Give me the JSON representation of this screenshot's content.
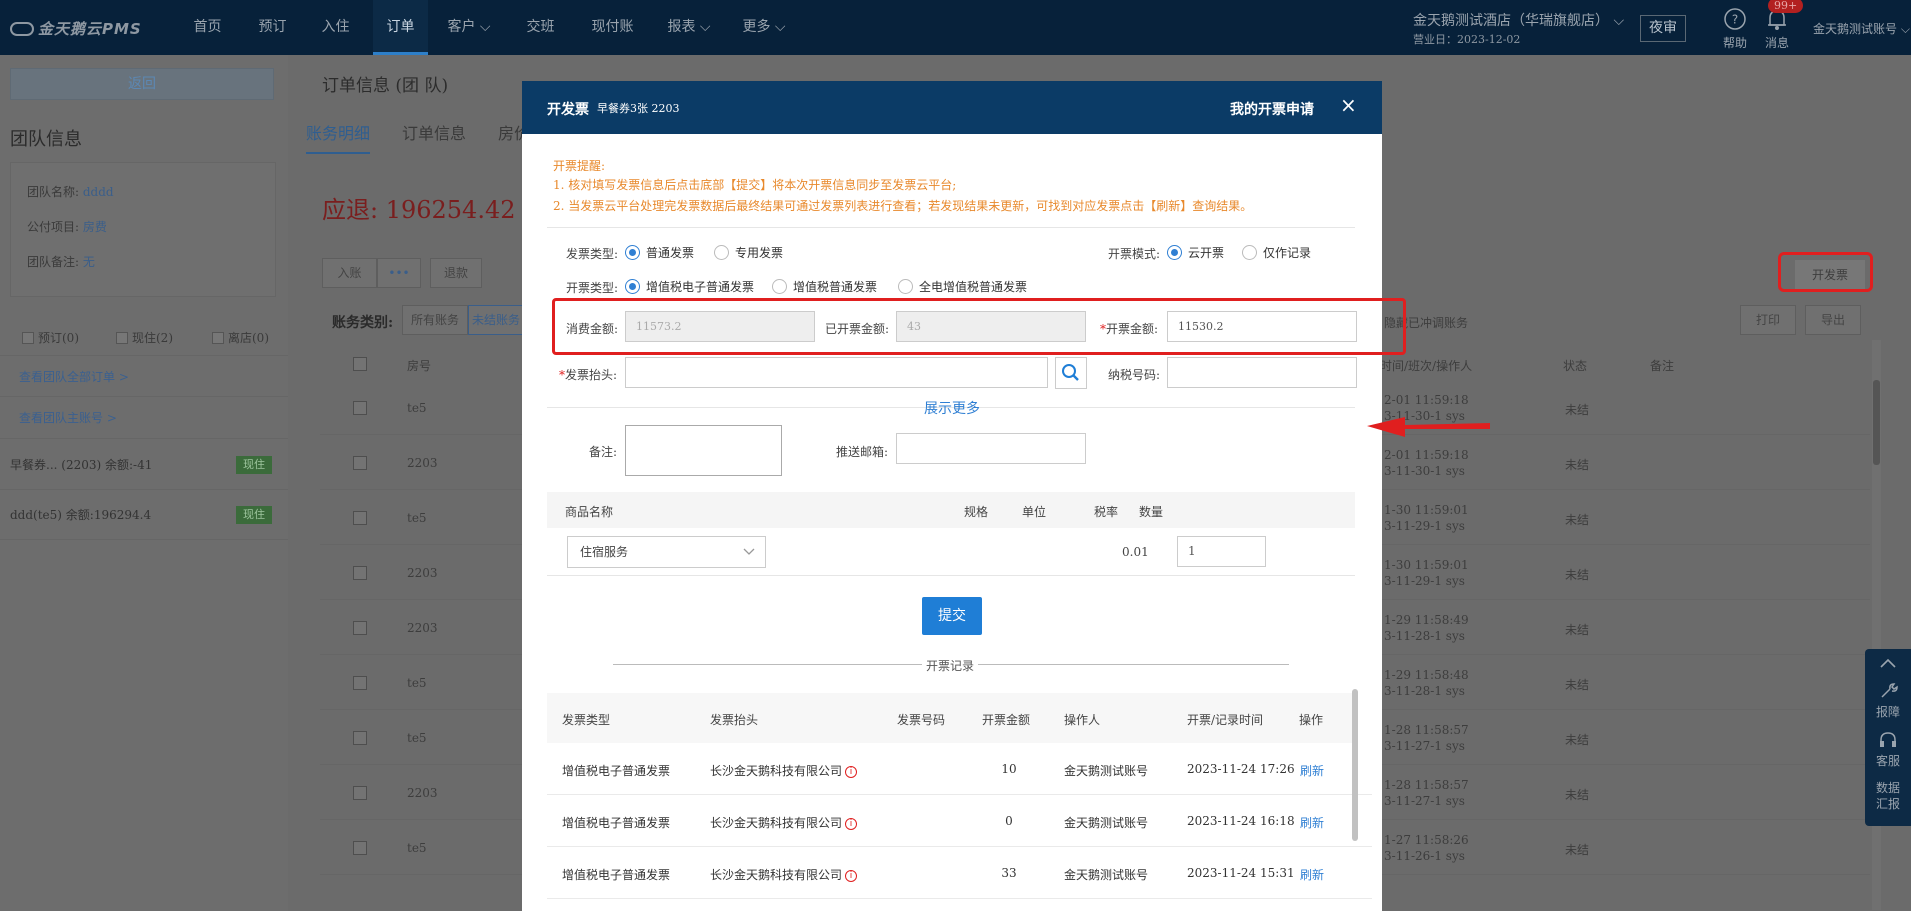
{
  "topbar": {
    "logo": "金天鹅云PMS",
    "nav": [
      {
        "label": "首页"
      },
      {
        "label": "预订"
      },
      {
        "label": "入住"
      },
      {
        "label": "订单"
      },
      {
        "label": "客户 ⌵"
      },
      {
        "label": "交班"
      },
      {
        "label": "现付账"
      },
      {
        "label": "报表 ⌵"
      },
      {
        "label": "更多 ⌵"
      }
    ],
    "hotel_name": "金天鹅测试酒店（华瑞旗舰店） ⌵",
    "business_date": "营业日：2023-12-02",
    "night_audit": "夜审",
    "help_label": "帮助",
    "messages_label": "消息",
    "message_badge": "99+",
    "user_name": "金天鹅测试账号 ⌵"
  },
  "left": {
    "back": "返回",
    "team_title": "团队信息",
    "team_name_label": "团队名称:",
    "team_name_value": "dddd",
    "pay_item_label": "公付项目:",
    "pay_item_value": "房费",
    "team_note_label": "团队备注:",
    "team_note_value": "无",
    "filters": [
      "预订(0)",
      "现住(2)",
      "离店(0)"
    ],
    "link_all_orders": "查看团队全部订单 >",
    "link_master": "查看团队主账号 >",
    "rooms": [
      {
        "text": "早餐券... (2203)  余额:-41",
        "tag": "现住"
      },
      {
        "text": "ddd(te5)  余额:196294.4",
        "tag": "现住"
      }
    ]
  },
  "main": {
    "order_title": "订单信息 (团 队)",
    "tabs": [
      "账务明细",
      "订单信息",
      "房价"
    ],
    "due": "应退:  196254.42",
    "btn_enter": "入账",
    "btn_more": "•••",
    "btn_refund": "退款",
    "category_label": "账务类别:",
    "category_all": "所有账务",
    "category_unsettled": "未结账务",
    "hide_offset": "隐藏已冲调账务",
    "print": "打印",
    "export": "导出",
    "invoice_btn": "开发票",
    "columns": {
      "room": "房号",
      "time_op": "时间/班次/操作人",
      "status": "状态",
      "note": "备注"
    },
    "rows": [
      {
        "room": "te5",
        "t1": "2-01 11:59:18",
        "t2": "3-11-30-1 sys",
        "status": "未结"
      },
      {
        "room": "2203",
        "t1": "2-01 11:59:18",
        "t2": "3-11-30-1 sys",
        "status": "未结"
      },
      {
        "room": "te5",
        "t1": "1-30 11:59:01",
        "t2": "3-11-29-1 sys",
        "status": "未结"
      },
      {
        "room": "2203",
        "t1": "1-30 11:59:01",
        "t2": "3-11-29-1 sys",
        "status": "未结"
      },
      {
        "room": "2203",
        "t1": "1-29 11:58:49",
        "t2": "3-11-28-1 sys",
        "status": "未结"
      },
      {
        "room": "te5",
        "t1": "1-29 11:58:48",
        "t2": "3-11-28-1 sys",
        "status": "未结"
      },
      {
        "room": "te5",
        "t1": "1-28 11:58:57",
        "t2": "3-11-27-1 sys",
        "status": "未结"
      },
      {
        "room": "2203",
        "t1": "1-28 11:58:57",
        "t2": "3-11-27-1 sys",
        "status": "未结"
      },
      {
        "room": "te5",
        "t1": "1-27 11:58:26",
        "t2": "3-11-26-1 sys",
        "status": "未结"
      }
    ]
  },
  "side_tools": [
    "报障",
    "客服",
    "数据汇报"
  ],
  "modal": {
    "title": "开发票",
    "subtitle": "早餐券3张   2203",
    "my_applications": "我的开票申请",
    "close": "×",
    "tip_title": "开票提醒:",
    "tip_1": "1. 核对填写发票信息后点击底部【提交】将本次开票信息同步至发票云平台;",
    "tip_2": "2. 当发票云平台处理完发票数据后最终结果可通过发票列表进行查看；若发现结果未更新，可找到对应发票点击【刷新】查询结果。",
    "invoice_type_label": "发票类型:",
    "invoice_type_opts": [
      "普通发票",
      "专用发票"
    ],
    "mode_label": "开票模式:",
    "mode_opts": [
      "云开票",
      "仅作记录"
    ],
    "kind_label": "开票类型:",
    "kind_opts": [
      "增值税电子普通发票",
      "增值税普通发票",
      "全电增值税普通发票"
    ],
    "consume_label": "消费金额:",
    "consume_value": "11573.2",
    "issued_label": "已开票金额:",
    "issued_value": "43",
    "amount_label": "开票金额:",
    "amount_value": "11530.2",
    "header_label": "发票抬头:",
    "header_value": "",
    "tax_label": "纳税号码:",
    "tax_value": "",
    "show_more": "展示更多",
    "remark_label": "备注:",
    "email_label": "推送邮箱:",
    "goods_cols": {
      "name": "商品名称",
      "spec": "规格",
      "unit": "单位",
      "rate": "税率",
      "qty": "数量"
    },
    "goods_row": {
      "name": "住宿服务",
      "rate": "0.01",
      "qty": "1"
    },
    "submit": "提交",
    "records_title": "开票记录",
    "record_cols": {
      "type": "发票类型",
      "header": "发票抬头",
      "number": "发票号码",
      "amount": "开票金额",
      "operator": "操作人",
      "time": "开票/记录时间",
      "action": "操作"
    },
    "records": [
      {
        "type": "增值税电子普通发票",
        "header": "长沙金天鹅科技有限公司",
        "amount": "10",
        "operator": "金天鹅测试账号",
        "time": "2023-11-24 17:26",
        "action": "刷新"
      },
      {
        "type": "增值税电子普通发票",
        "header": "长沙金天鹅科技有限公司",
        "amount": "0",
        "operator": "金天鹅测试账号",
        "time": "2023-11-24 16:18",
        "action": "刷新"
      },
      {
        "type": "增值税电子普通发票",
        "header": "长沙金天鹅科技有限公司",
        "amount": "33",
        "operator": "金天鹅测试账号",
        "time": "2023-11-24 15:31",
        "action": "刷新"
      }
    ]
  },
  "colors": {
    "nav_bg": "#07213a",
    "modal_header": "#0b3b66",
    "accent_blue": "#2f7fd3",
    "tip_orange": "#e8892c",
    "highlight_red": "#e01f1f"
  }
}
